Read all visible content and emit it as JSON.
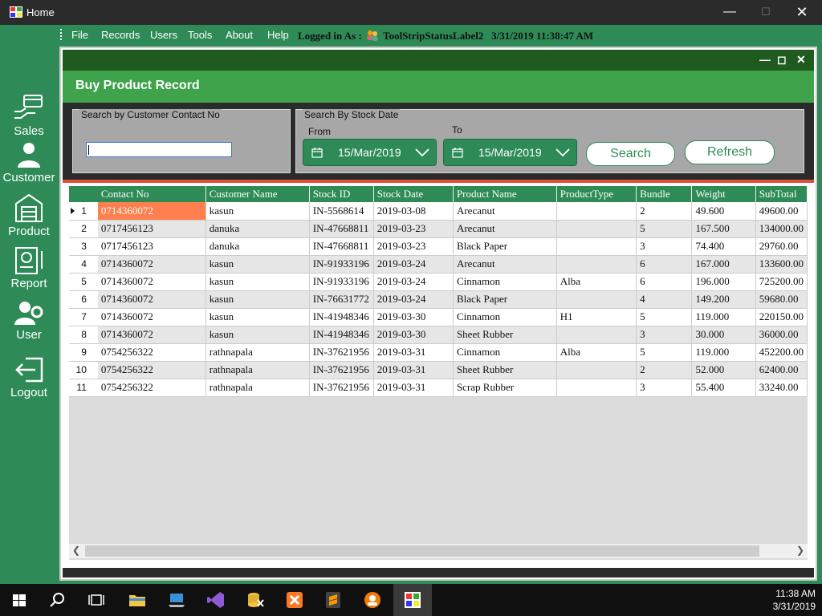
{
  "window": {
    "title": "Home"
  },
  "menu": {
    "items": [
      "File",
      "Records",
      "Users",
      "Tools",
      "About",
      "Help"
    ],
    "status_prefix": "Logged in As :",
    "status_user": "ToolStripStatusLabel2",
    "status_datetime": "3/31/2019 11:38:47 AM"
  },
  "sidebar": [
    {
      "label": "Sales",
      "icon": "sales-icon"
    },
    {
      "label": "Customer",
      "icon": "customer-icon"
    },
    {
      "label": "Product",
      "icon": "product-icon"
    },
    {
      "label": "Report",
      "icon": "report-icon"
    },
    {
      "label": "User",
      "icon": "user-icon"
    },
    {
      "label": "Logout",
      "icon": "logout-icon"
    }
  ],
  "form": {
    "title": "Buy Product Record",
    "contact_group": "Search by Customer Contact No",
    "contact_value": "",
    "date_group": "Search By Stock Date",
    "from_label": "From",
    "to_label": "To",
    "from_date": "15/Mar/2019",
    "to_date": "15/Mar/2019",
    "search_label": "Search",
    "refresh_label": "Refresh"
  },
  "grid": {
    "columns": [
      "Contact No",
      "Customer Name",
      "Stock ID",
      "Stock Date",
      "Product Name",
      "ProductType",
      "Bundle",
      "Weight",
      "SubTotal"
    ],
    "rows": [
      [
        "1",
        "0714360072",
        "kasun",
        "IN-5568614",
        "2019-03-08",
        "Arecanut",
        "",
        "2",
        "49.600",
        "49600.00"
      ],
      [
        "2",
        "0717456123",
        "danuka",
        "IN-47668811",
        "2019-03-23",
        "Arecanut",
        "",
        "5",
        "167.500",
        "134000.00"
      ],
      [
        "3",
        "0717456123",
        "danuka",
        "IN-47668811",
        "2019-03-23",
        "Black Paper",
        "",
        "3",
        "74.400",
        "29760.00"
      ],
      [
        "4",
        "0714360072",
        "kasun",
        "IN-91933196",
        "2019-03-24",
        "Arecanut",
        "",
        "6",
        "167.000",
        "133600.00"
      ],
      [
        "5",
        "0714360072",
        "kasun",
        "IN-91933196",
        "2019-03-24",
        "Cinnamon",
        "Alba",
        "6",
        "196.000",
        "725200.00"
      ],
      [
        "6",
        "0714360072",
        "kasun",
        "IN-76631772",
        "2019-03-24",
        "Black Paper",
        "",
        "4",
        "149.200",
        "59680.00"
      ],
      [
        "7",
        "0714360072",
        "kasun",
        "IN-41948346",
        "2019-03-30",
        "Cinnamon",
        "H1",
        "5",
        "119.000",
        "220150.00"
      ],
      [
        "8",
        "0714360072",
        "kasun",
        "IN-41948346",
        "2019-03-30",
        "Sheet Rubber",
        "",
        "3",
        "30.000",
        "36000.00"
      ],
      [
        "9",
        "0754256322",
        "rathnapala",
        "IN-37621956",
        "2019-03-31",
        "Cinnamon",
        "Alba",
        "5",
        "119.000",
        "452200.00"
      ],
      [
        "10",
        "0754256322",
        "rathnapala",
        "IN-37621956",
        "2019-03-31",
        "Sheet Rubber",
        "",
        "2",
        "52.000",
        "62400.00"
      ],
      [
        "11",
        "0754256322",
        "rathnapala",
        "IN-37621956",
        "2019-03-31",
        "Scrap Rubber",
        "",
        "3",
        "55.400",
        "33240.00"
      ]
    ]
  },
  "taskbar": {
    "time": "11:38 AM",
    "date": "3/31/2019"
  },
  "colors": {
    "accent": "#2e8b57",
    "header": "#3ea34a",
    "selection": "#ff7f4f"
  }
}
